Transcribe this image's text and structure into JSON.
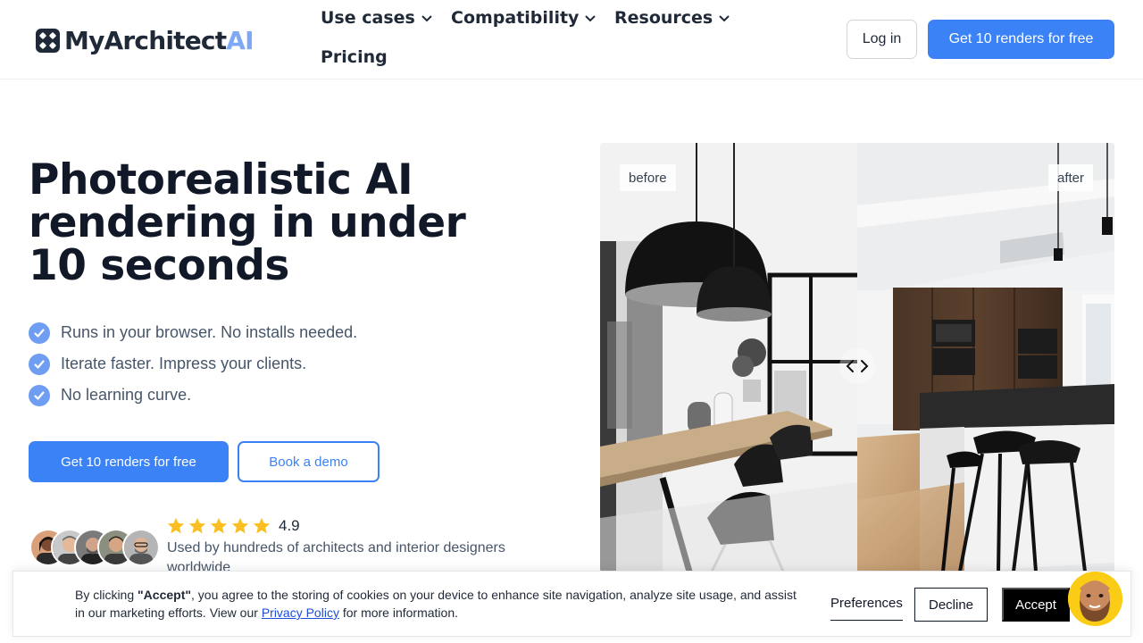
{
  "brand": {
    "name_main": "MyArchitect",
    "name_accent": "AI",
    "accent_color": "#7ea8f6",
    "primary_color": "#3b82f6"
  },
  "nav": {
    "use_cases": "Use cases",
    "compatibility": "Compatibility",
    "resources": "Resources",
    "pricing": "Pricing",
    "login": "Log in",
    "cta": "Get 10 renders for free"
  },
  "hero": {
    "title_line1": "Photorealistic AI",
    "title_line2": "rendering in under",
    "title_line3": "10 seconds",
    "bullets": [
      "Runs in your browser. No installs needed.",
      "Iterate faster. Impress your clients.",
      "No learning curve."
    ],
    "cta_primary": "Get 10 renders for free",
    "cta_secondary": "Book a demo",
    "rating": "4.9",
    "rating_stars": 5,
    "social_proof": "Used by hundreds of architects and interior designers worldwide"
  },
  "compare": {
    "before_label": "before",
    "after_label": "after"
  },
  "cookie": {
    "text_prefix": "By clicking ",
    "text_accept_word": "\"Accept\"",
    "text_middle": ", you agree to the storing of cookies on your device to enhance site navigation, analyze site usage, and assist in our marketing efforts. View our ",
    "privacy_link": "Privacy Policy",
    "text_suffix": " for more information.",
    "preferences": "Preferences",
    "decline": "Decline",
    "accept": "Accept"
  }
}
